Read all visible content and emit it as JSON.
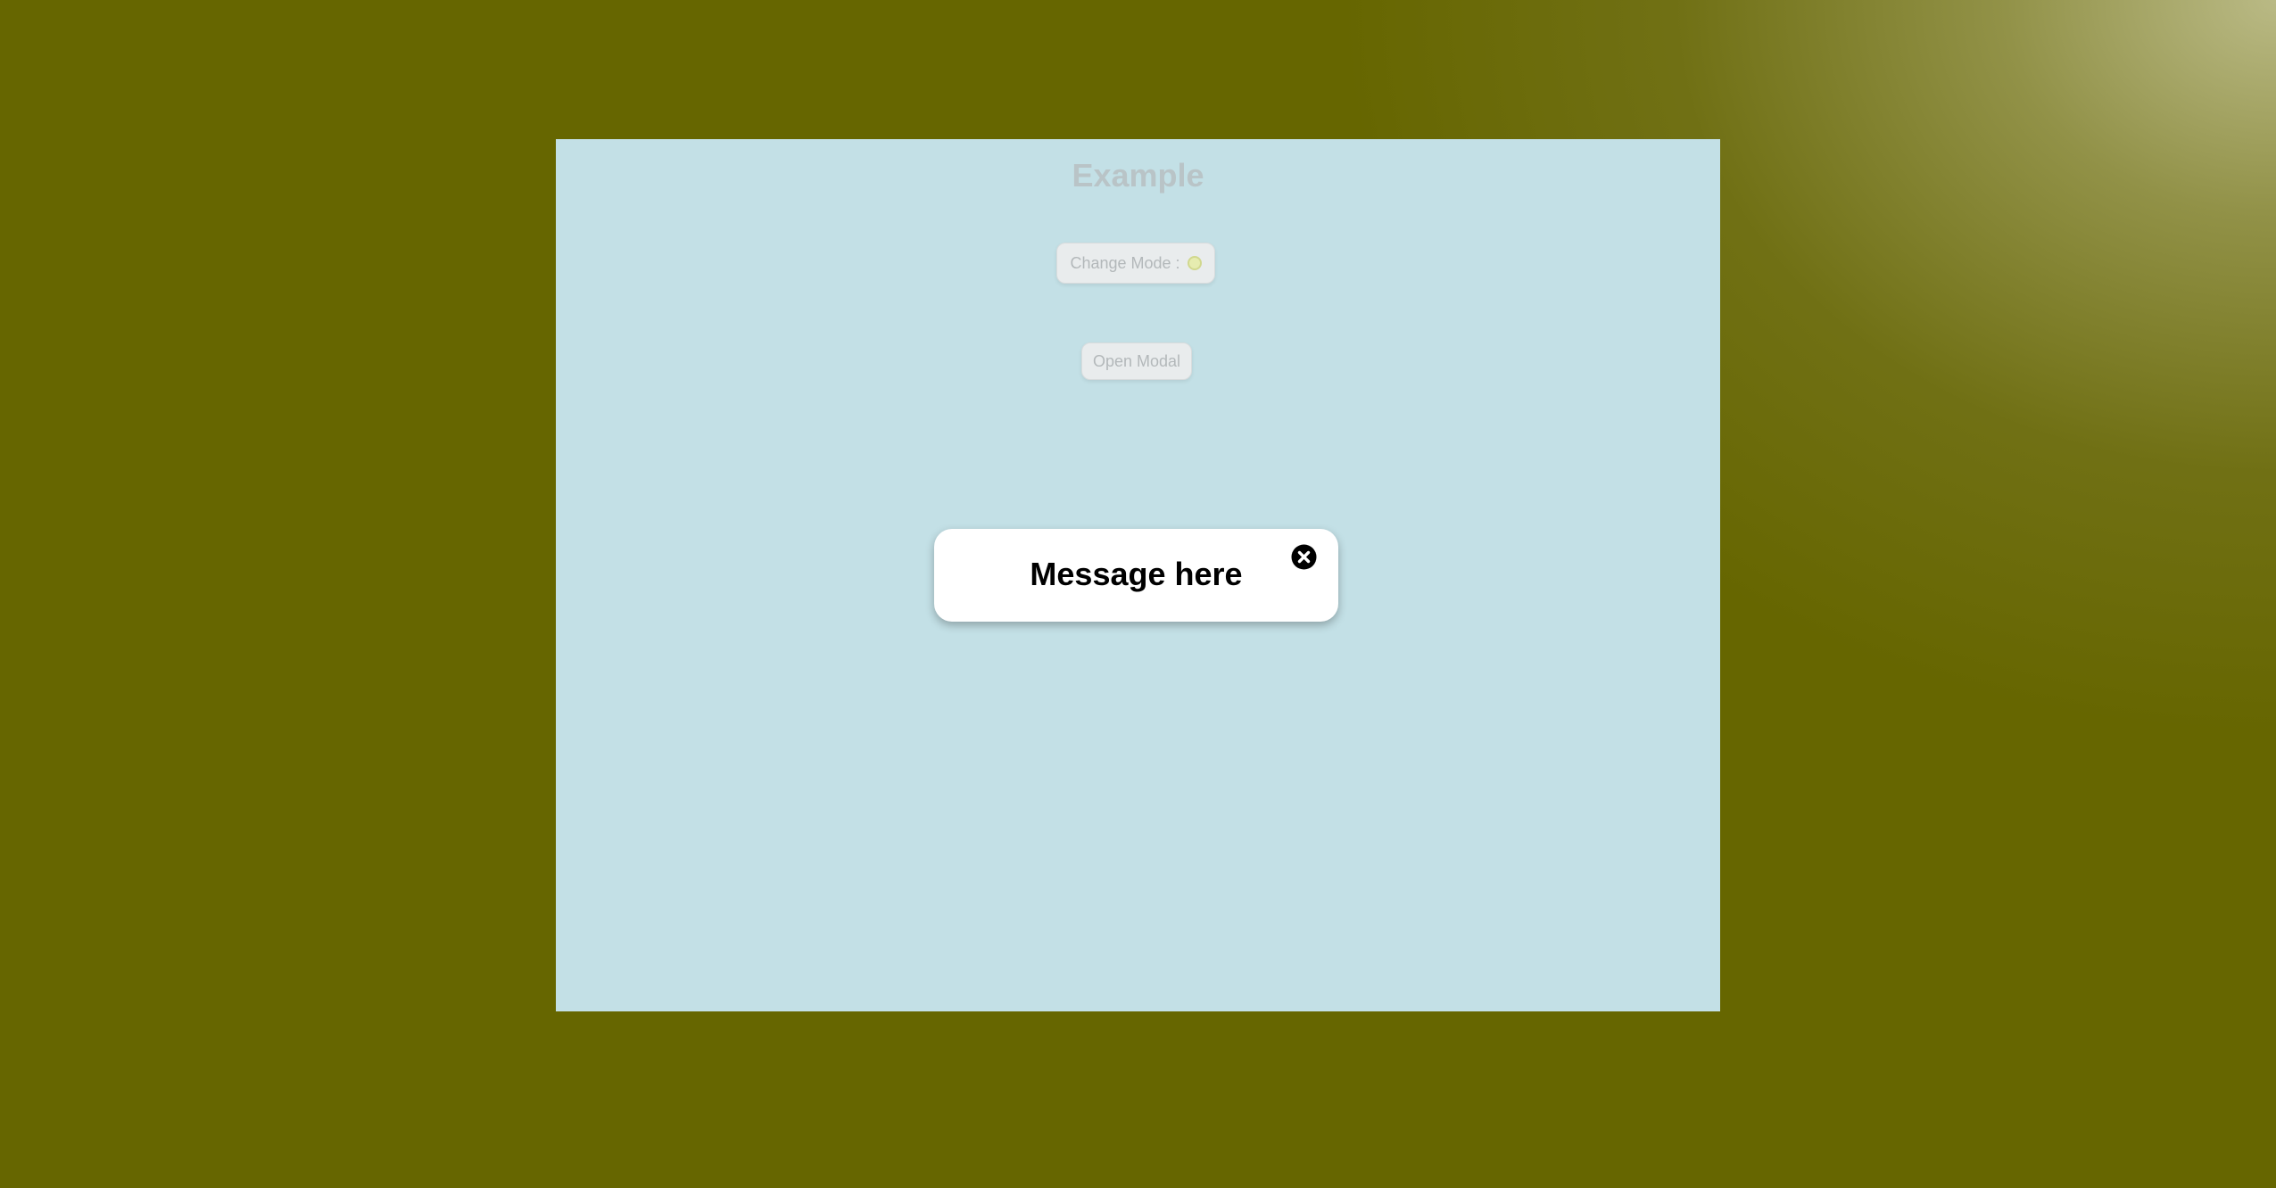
{
  "page": {
    "title": "Example",
    "mode_button_label": "Change Mode :",
    "open_modal_label": "Open Modal"
  },
  "modal": {
    "message": "Message here",
    "close_icon": "close-circle-icon"
  },
  "colors": {
    "outer_background": "#666600",
    "frame_background": "#c3e0e6",
    "modal_background": "#ffffff",
    "mode_indicator": "#e6ecb0"
  }
}
